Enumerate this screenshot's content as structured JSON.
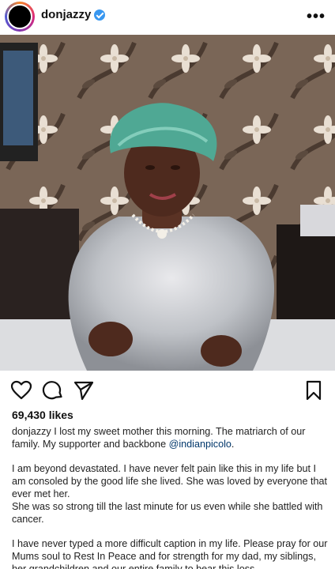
{
  "post": {
    "username": "donjazzy",
    "verified": true,
    "more_icon": "more-horizontal-icon"
  },
  "actions": {
    "like_icon": "heart-icon",
    "comment_icon": "comment-icon",
    "share_icon": "send-icon",
    "save_icon": "bookmark-icon"
  },
  "likes": "69,430 likes",
  "caption": {
    "username": "donjazzy",
    "p1_text": " I lost my sweet mother this morning. The matriarch of our family. My supporter and backbone ",
    "mention": "@indianpicolo",
    "p1_end": ".",
    "p2": "I am beyond devastated. I have never felt pain like this in my life but I am consoled by the good life she lived. She was loved by everyone that ever met her.",
    "p3": "She was so strong till the last minute for us even while she battled with cancer.",
    "p4": "I have never typed a more difficult caption in my life. Please pray for our Mums soul to Rest In Peace and for strength for my dad, my siblings, her grandchildren and our entire family to bear this loss."
  },
  "colors": {
    "verified": "#3897f0",
    "mention": "#00376b"
  }
}
